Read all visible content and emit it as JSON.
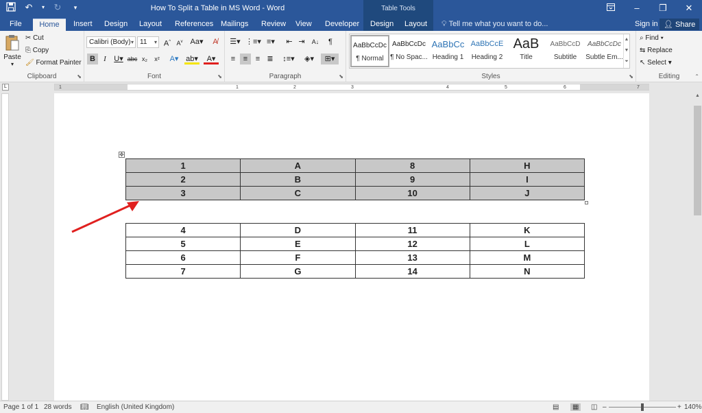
{
  "window": {
    "title": "How To Split a Table in MS Word - Word",
    "context_tab_group": "Table Tools"
  },
  "tabs": [
    "File",
    "Home",
    "Insert",
    "Design",
    "Layout",
    "References",
    "Mailings",
    "Review",
    "View",
    "Developer",
    "Design",
    "Layout"
  ],
  "tell_me": "Tell me what you want to do...",
  "sign_in": "Sign in",
  "share": "Share",
  "clipboard": {
    "label": "Clipboard",
    "paste": "Paste",
    "cut": "Cut",
    "copy": "Copy",
    "format_painter": "Format Painter"
  },
  "font": {
    "label": "Font",
    "family": "Calibri (Body)",
    "size": "11"
  },
  "paragraph": {
    "label": "Paragraph"
  },
  "styles": {
    "label": "Styles",
    "items": [
      {
        "preview": "AaBbCcDc",
        "name": "¶ Normal"
      },
      {
        "preview": "AaBbCcDc",
        "name": "¶ No Spac..."
      },
      {
        "preview": "AaBbCc",
        "name": "Heading 1"
      },
      {
        "preview": "AaBbCcE",
        "name": "Heading 2"
      },
      {
        "preview": "AaB",
        "name": "Title"
      },
      {
        "preview": "AaBbCcD",
        "name": "Subtitle"
      },
      {
        "preview": "AaBbCcDc",
        "name": "Subtle Em..."
      }
    ]
  },
  "editing": {
    "label": "Editing",
    "find": "Find",
    "replace": "Replace",
    "select": "Select"
  },
  "ruler_numbers": [
    "1",
    "1",
    "2",
    "3",
    "4",
    "5",
    "6",
    "7"
  ],
  "table1": {
    "rows": [
      [
        "1",
        "A",
        "8",
        "H"
      ],
      [
        "2",
        "B",
        "9",
        "I"
      ],
      [
        "3",
        "C",
        "10",
        "J"
      ]
    ]
  },
  "table2": {
    "rows": [
      [
        "4",
        "D",
        "11",
        "K"
      ],
      [
        "5",
        "E",
        "12",
        "L"
      ],
      [
        "6",
        "F",
        "13",
        "M"
      ],
      [
        "7",
        "G",
        "14",
        "N"
      ]
    ]
  },
  "status": {
    "page": "Page 1 of 1",
    "words": "28 words",
    "language": "English (United Kingdom)",
    "zoom": "140%"
  },
  "colors": {
    "brand": "#2b579a",
    "context": "#1f497d",
    "arrow": "#e0201f",
    "shading": "#c8c8c8"
  }
}
